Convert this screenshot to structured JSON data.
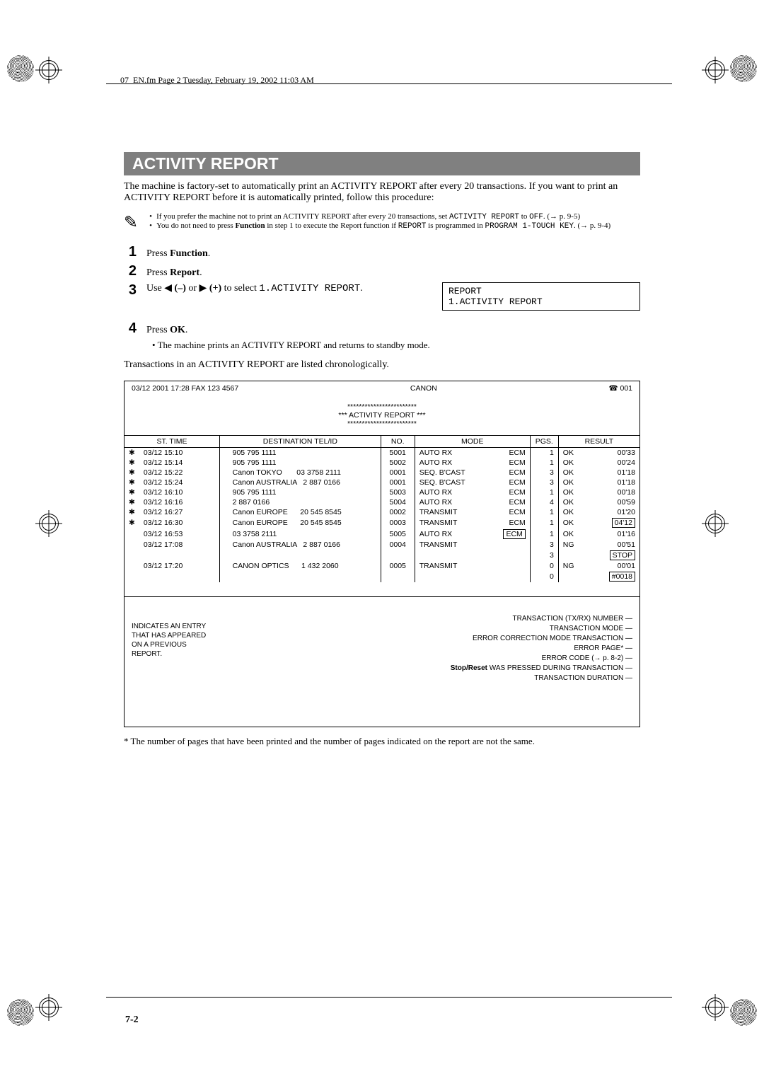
{
  "header": "07_EN.fm  Page 2  Tuesday, February 19, 2002  11:03 AM",
  "title": "ACTIVITY REPORT",
  "intro": "The machine is factory-set to automatically print an ACTIVITY REPORT after every 20 transactions. If you want to print an ACTIVITY REPORT before it is automatically printed, follow this procedure:",
  "notes": {
    "n1a": "If you prefer the machine not to print an ACTIVITY REPORT after every 20 transactions, set ",
    "n1b": "ACTIVITY REPORT",
    "n1c": " to ",
    "n1d": "OFF",
    "n1e": ". (→ p. 9-5)",
    "n2a": "You do not need to press ",
    "n2b": "Function",
    "n2c": " in step 1 to execute the Report function if ",
    "n2d": "REPORT",
    "n2e": " is programmed in ",
    "n2f": "PROGRAM 1-TOUCH KEY",
    "n2g": ". (→ p. 9-4)"
  },
  "steps": {
    "s1": {
      "num": "1",
      "a": "Press ",
      "b": "Function",
      "c": "."
    },
    "s2": {
      "num": "2",
      "a": "Press ",
      "b": "Report",
      "c": "."
    },
    "s3": {
      "num": "3",
      "a": "Use ◀ ",
      "b": "(–)",
      "c": " or ▶ ",
      "d": "(+)",
      "e": " to select ",
      "f": "1.ACTIVITY REPORT",
      "g": "."
    },
    "display": {
      "line1": "REPORT",
      "line2": "1.ACTIVITY REPORT"
    },
    "s4": {
      "num": "4",
      "a": "Press ",
      "b": "OK",
      "c": ".",
      "note": "The machine prints an ACTIVITY REPORT and returns to standby mode."
    }
  },
  "chrono": "Transactions in an ACTIVITY REPORT are listed chronologically.",
  "report": {
    "hdr_left": "03/12 2001 17:28 FAX 123 4567",
    "hdr_center": "CANON",
    "hdr_right": "☎ 001",
    "sep": "************************",
    "banner": "***   ACTIVITY REPORT   ***",
    "cols": {
      "time": "ST. TIME",
      "dest": "DESTINATION TEL/ID",
      "no": "NO.",
      "mode": "MODE",
      "pgs": "PGS.",
      "result": "RESULT"
    },
    "rows": [
      {
        "star": "✱",
        "time": "03/12 15:10",
        "dest": "905 795 1111",
        "no": "5001",
        "mode": "AUTO RX",
        "ecm": "ECM",
        "pgs": "1",
        "res1": "OK",
        "res2": "00'33"
      },
      {
        "star": "✱",
        "time": "03/12 15:14",
        "dest": "905 795 1111",
        "no": "5002",
        "mode": "AUTO RX",
        "ecm": "ECM",
        "pgs": "1",
        "res1": "OK",
        "res2": "00'24"
      },
      {
        "star": "✱",
        "time": "03/12 15:22",
        "dest": "Canon TOKYO       03 3758 2111",
        "no": "0001",
        "mode": "SEQ. B'CAST",
        "ecm": "ECM",
        "pgs": "3",
        "res1": "OK",
        "res2": "01'18"
      },
      {
        "star": "✱",
        "time": "03/12 15:24",
        "dest": "Canon AUSTRALIA   2 887 0166",
        "no": "0001",
        "mode": "SEQ. B'CAST",
        "ecm": "ECM",
        "pgs": "3",
        "res1": "OK",
        "res2": "01'18"
      },
      {
        "star": "✱",
        "time": "03/12 16:10",
        "dest": "905 795 1111",
        "no": "5003",
        "mode": "AUTO RX",
        "ecm": "ECM",
        "pgs": "1",
        "res1": "OK",
        "res2": "00'18"
      },
      {
        "star": "✱",
        "time": "03/12 16:16",
        "dest": "2 887 0166",
        "no": "5004",
        "mode": "AUTO RX",
        "ecm": "ECM",
        "pgs": "4",
        "res1": "OK",
        "res2": "00'59"
      },
      {
        "star": "✱",
        "time": "03/12 16:27",
        "dest": "Canon EUROPE      20 545 8545",
        "no": "0002",
        "mode": "TRANSMIT",
        "ecm": "ECM",
        "pgs": "1",
        "res1": "OK",
        "res2": "01'20"
      },
      {
        "star": "✱",
        "time": "03/12 16:30",
        "dest": "Canon EUROPE      20 545 8545",
        "no": "0003",
        "mode": "TRANSMIT",
        "ecm": "ECM",
        "pgs": "1",
        "res1": "OK",
        "res2": "04'12",
        "box2": true
      },
      {
        "star": "",
        "time": "03/12 16:53",
        "dest": "03 3758 2111",
        "no": "5005",
        "mode": "AUTO RX",
        "ecm": "ECM",
        "ecmbox": true,
        "pgs": "1",
        "res1": "OK",
        "res2": "01'16"
      },
      {
        "star": "",
        "time": "03/12 17:08",
        "dest": "Canon AUSTRALIA   2 887 0166",
        "no": "0004",
        "mode": "TRANSMIT",
        "ecm": "",
        "pgs": "3",
        "res1": "NG",
        "res2": "00'51"
      },
      {
        "star": "",
        "time": "",
        "dest": "",
        "no": "",
        "mode": "",
        "ecm": "",
        "pgs": "3",
        "res1": "",
        "res2": "STOP",
        "box2": true
      },
      {
        "star": "",
        "time": "03/12 17:20",
        "dest": "CANON OPTICS      1 432 2060",
        "no": "0005",
        "mode": "TRANSMIT",
        "ecm": "",
        "pgs": "0",
        "res1": "NG",
        "res2": "00'01"
      },
      {
        "star": "",
        "time": "",
        "dest": "",
        "no": "",
        "mode": "",
        "ecm": "",
        "pgs": "0",
        "res1": "",
        "res2": "#0018",
        "box2": true
      }
    ],
    "annot_indic": "INDICATES AN ENTRY THAT HAS APPEARED ON A PREVIOUS REPORT.",
    "annot": {
      "txrx": "TRANSACTION (TX/RX) NUMBER",
      "mode": "TRANSACTION MODE",
      "ecm": "ERROR CORRECTION MODE TRANSACTION",
      "errpage": "ERROR PAGE*",
      "errcode": "ERROR CODE (→ p. 8-2)",
      "stop": "Stop/Reset WAS PRESSED DURING TRANSACTION",
      "stop_b": "Stop/Reset",
      "stop_r": " WAS PRESSED DURING TRANSACTION",
      "dur": "TRANSACTION DURATION"
    }
  },
  "footnote": "*   The number of pages that have been printed and the number of pages indicated on the report are not the same.",
  "page_num": "7-2"
}
